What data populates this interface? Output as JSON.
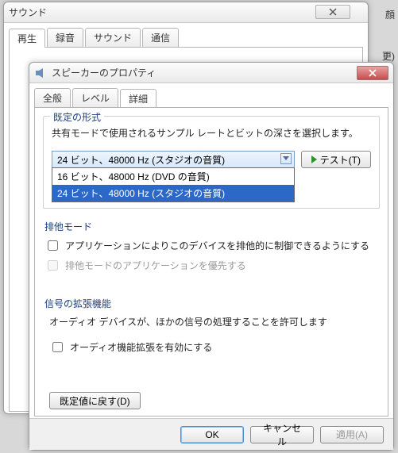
{
  "bgWindow": {
    "title": "サウンド",
    "tabs": [
      "再生",
      "録音",
      "サウンド",
      "通信"
    ],
    "cutoff1": "顔",
    "cutoff2": "更)"
  },
  "dialog": {
    "title": "スピーカーのプロパティ",
    "tabs": {
      "general": "全般",
      "level": "レベル",
      "advanced": "詳細"
    },
    "defaultFormat": {
      "legend": "既定の形式",
      "desc": "共有モードで使用されるサンプル レートとビットの深さを選択します。",
      "selected": "24 ビット、48000 Hz (スタジオの音質)",
      "options": [
        "16 ビット、48000 Hz (DVD の音質)",
        "24 ビット、48000 Hz (スタジオの音質)"
      ],
      "testBtn": "テスト(T)"
    },
    "exclusive": {
      "legend": "排他モード",
      "chk1": "アプリケーションによりこのデバイスを排他的に制御できるようにする",
      "chk2": "排他モードのアプリケーションを優先する"
    },
    "enhance": {
      "legend": "信号の拡張機能",
      "desc": "オーディオ デバイスが、ほかの信号の処理することを許可します",
      "chk": "オーディオ機能拡張を有効にする"
    },
    "restoreBtn": "既定値に戻す(D)",
    "footer": {
      "ok": "OK",
      "cancel": "キャンセル",
      "apply": "適用(A)"
    }
  }
}
